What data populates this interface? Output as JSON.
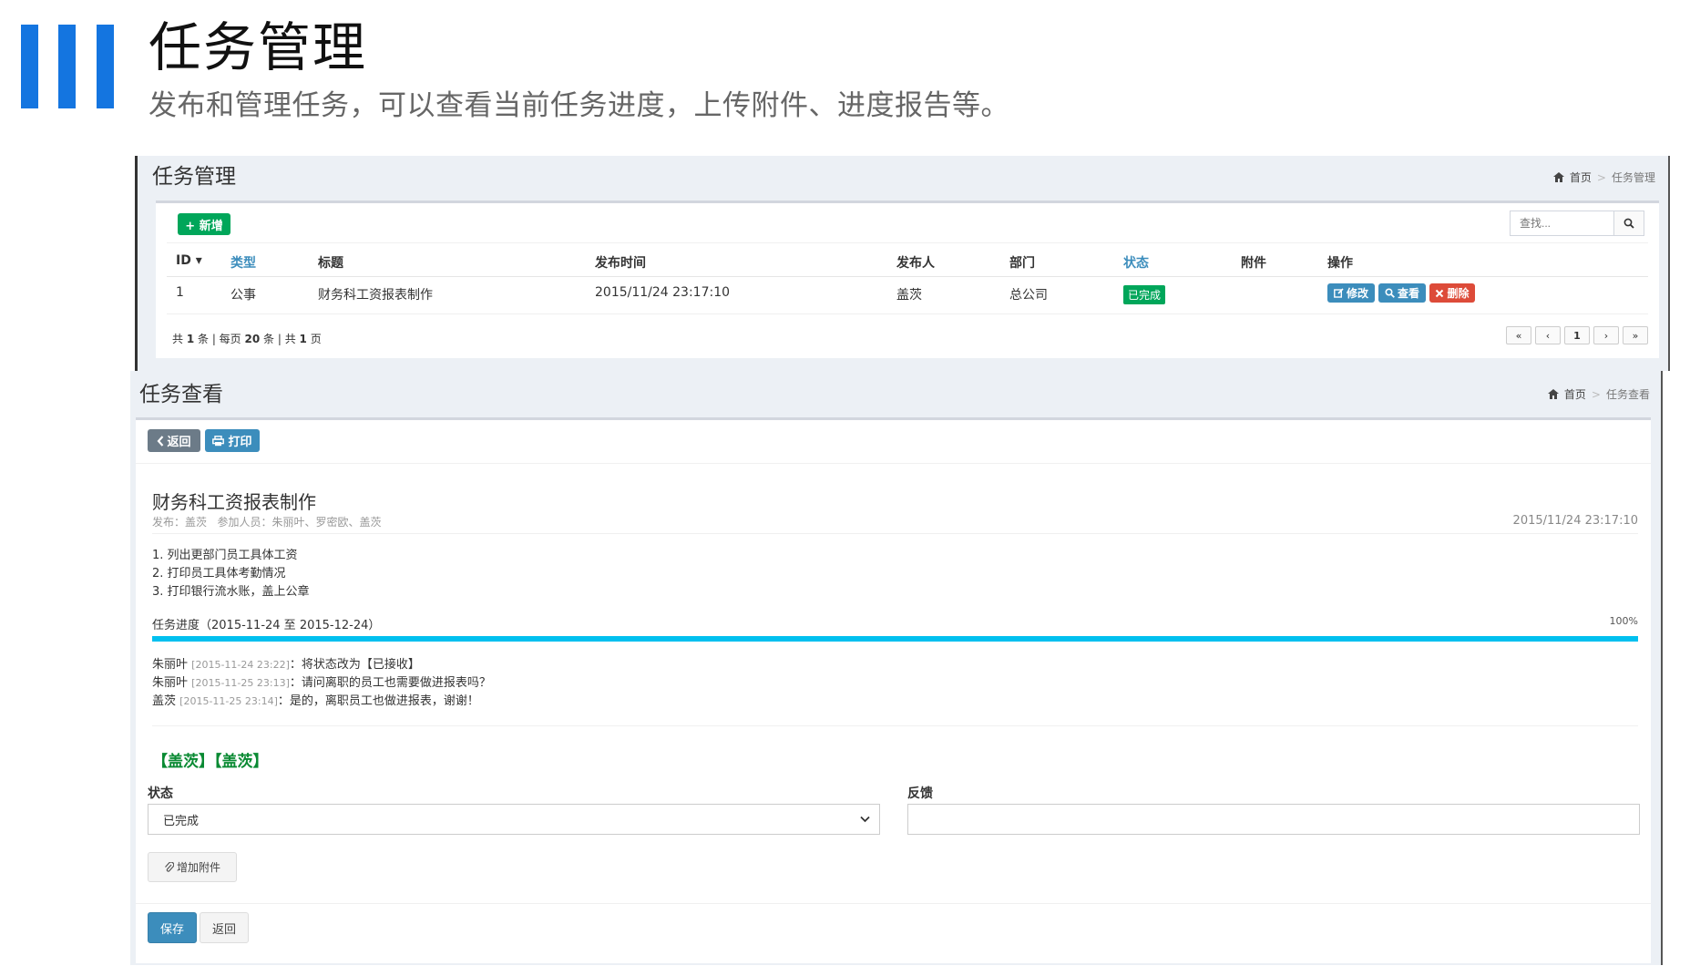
{
  "slide": {
    "title": "任务管理",
    "subtitle": "发布和管理任务，可以查看当前任务进度，上传附件、进度报告等。",
    "accent": "#1475e0"
  },
  "list_page": {
    "header": "任务管理",
    "breadcrumb": {
      "home": "首页",
      "current": "任务管理"
    },
    "add_button": "+ 新增",
    "search_placeholder": "查找...",
    "columns": [
      "ID ▾",
      "类型",
      "标题",
      "发布时间",
      "发布人",
      "部门",
      "状态",
      "附件",
      "操作"
    ],
    "rows": [
      {
        "id": "1",
        "type": "公事",
        "title": "财务科工资报表制作",
        "time": "2015/11/24 23:17:10",
        "publisher": "盖茨",
        "dept": "总公司",
        "status": "已完成",
        "attachment": ""
      }
    ],
    "row_actions": {
      "edit": "修改",
      "view": "查看",
      "delete": "删除"
    },
    "summary": {
      "p1": "共 ",
      "count": "1",
      "p2": " 条 | 每页 ",
      "per_page": "20",
      "p3": " 条 | 共 ",
      "pages": "1",
      "p4": " 页"
    },
    "pagination": [
      "«",
      "‹",
      "1",
      "›",
      "»"
    ]
  },
  "detail_page": {
    "header": "任务查看",
    "breadcrumb": {
      "home": "首页",
      "current": "任务查看"
    },
    "back_button": "返回",
    "print_button": "打印",
    "task_title": "财务科工资报表制作",
    "meta": "发布：盖茨   参加人员：朱丽叶、罗密欧、盖茨",
    "publish_time": "2015/11/24 23:17:10",
    "steps": [
      "1. 列出更部门员工具体工资",
      "2. 打印员工具体考勤情况",
      "3. 打印银行流水账，盖上公章"
    ],
    "progress_label": "任务进度（2015-11-24 至 2015-12-24）",
    "progress_text": "100%",
    "progress_value": 1.0,
    "progress_color": "#00c0ef",
    "logs": [
      {
        "user": "朱丽叶",
        "time": "[2015-11-24 23:22]",
        "text": "：将状态改为【已接收】"
      },
      {
        "user": "朱丽叶",
        "time": "[2015-11-25 23:13]",
        "text": "：请问离职的员工也需要做进报表吗？"
      },
      {
        "user": "盖茨",
        "time": "[2015-11-25 23:14]",
        "text": "：是的，离职员工也做进报表，谢谢！"
      }
    ],
    "tags": "【盖茨】【盖茨】",
    "status_label": "状态",
    "status_value": "已完成",
    "feedback_label": "反馈",
    "feedback_value": "",
    "attach_button": "增加附件",
    "save_button": "保存",
    "cancel_button": "返回"
  }
}
